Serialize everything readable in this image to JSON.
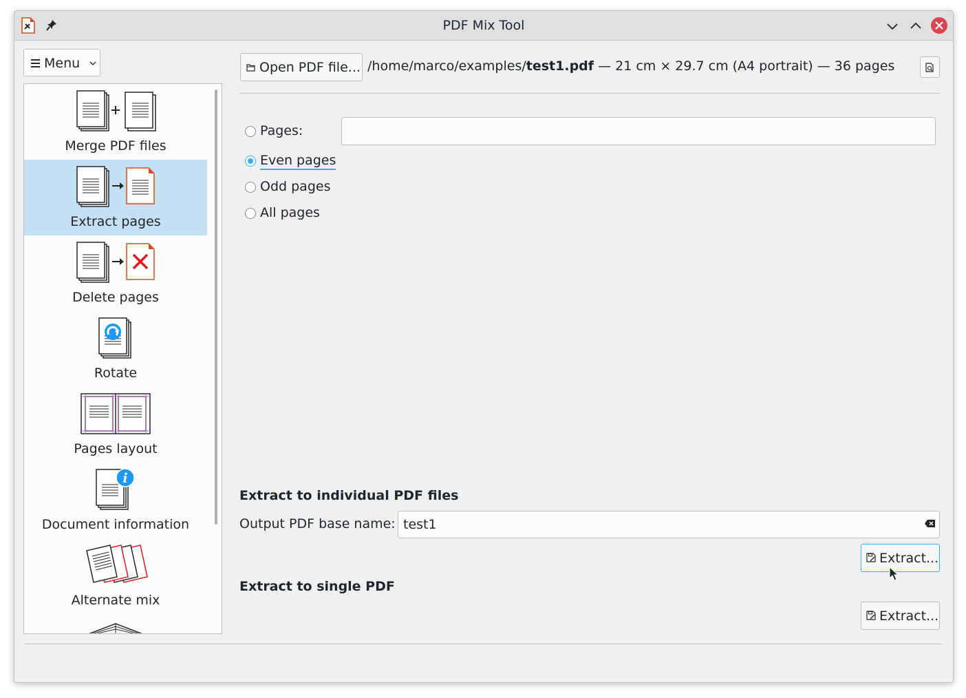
{
  "window": {
    "title": "PDF Mix Tool",
    "icons": [
      "app-icon",
      "pin-icon",
      "chevron-down-icon",
      "chevron-up-icon",
      "close-icon"
    ]
  },
  "menu": {
    "label": "Menu",
    "icon": "hamburger-icon"
  },
  "sidebar": {
    "items": [
      {
        "label": "Merge PDF files",
        "icon": "merge-pdf-icon",
        "selected": false
      },
      {
        "label": "Extract pages",
        "icon": "extract-pages-icon",
        "selected": true
      },
      {
        "label": "Delete pages",
        "icon": "delete-pages-icon",
        "selected": false
      },
      {
        "label": "Rotate",
        "icon": "rotate-icon",
        "selected": false
      },
      {
        "label": "Pages layout",
        "icon": "pages-layout-icon",
        "selected": false
      },
      {
        "label": "Document information",
        "icon": "document-information-icon",
        "selected": false
      },
      {
        "label": "Alternate mix",
        "icon": "alternate-mix-icon",
        "selected": false
      }
    ]
  },
  "file": {
    "open_label": "Open PDF file...",
    "path": "/home/marco/examples/",
    "name": "test1.pdf",
    "details": " — 21 cm × 29.7 cm (A4 portrait) — 36 pages"
  },
  "options": {
    "pages_label": "Pages:",
    "pages_value": "",
    "even_label": "Even pages",
    "odd_label": "Odd pages",
    "all_label": "All pages",
    "selected": "Even pages"
  },
  "individual": {
    "title": "Extract to individual PDF files",
    "base_name_label": "Output PDF base name:",
    "base_name_value": "test1",
    "extract_label": "Extract..."
  },
  "single": {
    "title": "Extract to single PDF",
    "extract_label": "Extract..."
  },
  "colors": {
    "accent": "#3daee9",
    "selection": "#c5dff3",
    "close": "#da4453"
  }
}
